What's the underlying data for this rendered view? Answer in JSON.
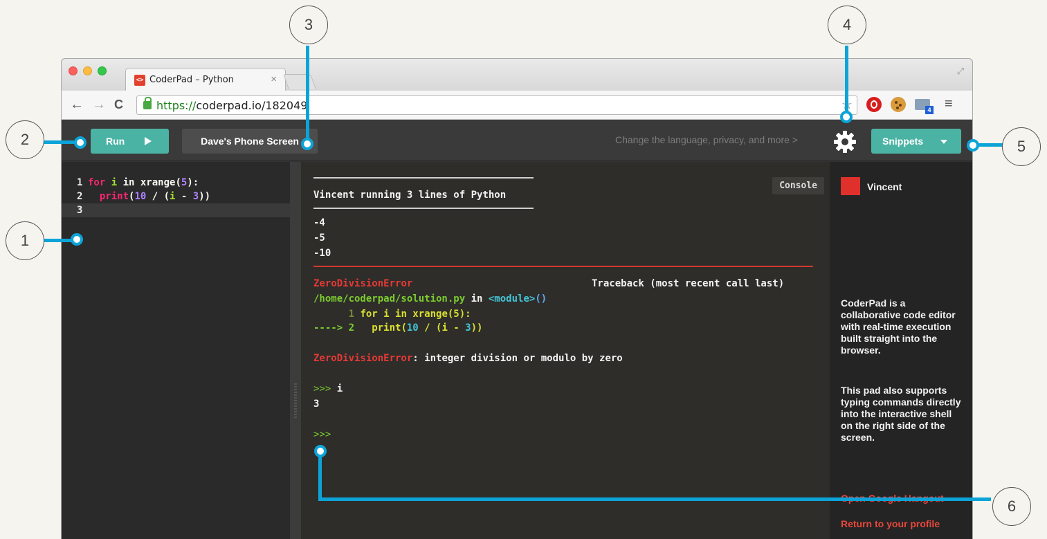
{
  "browser": {
    "tab_title": "CoderPad – Python",
    "tab_favicon": "<>",
    "tab_close": "×",
    "url_scheme": "https://",
    "url_rest": "coderpad.io/182049",
    "icons": [
      "back-arrow-icon",
      "forward-arrow-icon",
      "reload-icon",
      "lock-icon",
      "star-icon",
      "opera-icon",
      "cookie-icon",
      "cast-icon",
      "menu-icon",
      "fullscreen-icon"
    ]
  },
  "toolbar": {
    "run_label": "Run",
    "pad_title": "Dave's Phone Screen",
    "settings_hint": "Change the language, privacy, and more  >",
    "snippets_label": "Snippets"
  },
  "editor": {
    "lines": [
      {
        "num": "1",
        "parts": [
          [
            "k",
            "for "
          ],
          [
            "v",
            "i"
          ],
          [
            "t",
            " in xrange("
          ],
          [
            "n",
            "5"
          ],
          [
            "t",
            "):"
          ]
        ]
      },
      {
        "num": "2",
        "parts": [
          [
            "t",
            "  "
          ],
          [
            "f",
            "print"
          ],
          [
            "t",
            "("
          ],
          [
            "n",
            "10"
          ],
          [
            "t",
            " / ("
          ],
          [
            "v",
            "i"
          ],
          [
            "t",
            " - "
          ],
          [
            "n",
            "3"
          ],
          [
            "t",
            "))"
          ]
        ]
      },
      {
        "num": "3",
        "parts": []
      }
    ]
  },
  "console": {
    "tab_label": "Console",
    "header": "Vincent running 3 lines of Python",
    "outputs": [
      "-4",
      "-5",
      "-10"
    ],
    "error_name": "ZeroDivisionError",
    "traceback_label": "Traceback (most recent call last)",
    "trace_file": "/home/coderpad/solution.py",
    "trace_in": " in ",
    "trace_module": "<module>",
    "trace_parens": "()",
    "trace_line1_num": "      1 ",
    "trace_line1_code": "for i in xrange(5):",
    "trace_line2_arrow": "----> 2 ",
    "trace_line2_pre": "  print(",
    "trace_line2_n1": "10",
    "trace_line2_mid": " / (i - ",
    "trace_line2_n2": "3",
    "trace_line2_post": "))",
    "error_message": ": integer division or modulo by zero",
    "prompt": ">>>",
    "input_1": " i",
    "result_1": "3"
  },
  "sidebar": {
    "user_name": "Vincent",
    "user_color": "#e0302b",
    "desc_1": "CoderPad is a collaborative code editor with real-time execution built straight into the browser.",
    "desc_2": "This pad also supports typing commands directly into the interactive shell on the right side of the screen.",
    "link_hangout": "Open Google Hangout",
    "link_profile": "Return to your profile"
  },
  "callouts": [
    "1",
    "2",
    "3",
    "4",
    "5",
    "6"
  ],
  "colors": {
    "accent": "#4bb3a4",
    "callout": "#0ca4d8",
    "error": "#e53935"
  }
}
